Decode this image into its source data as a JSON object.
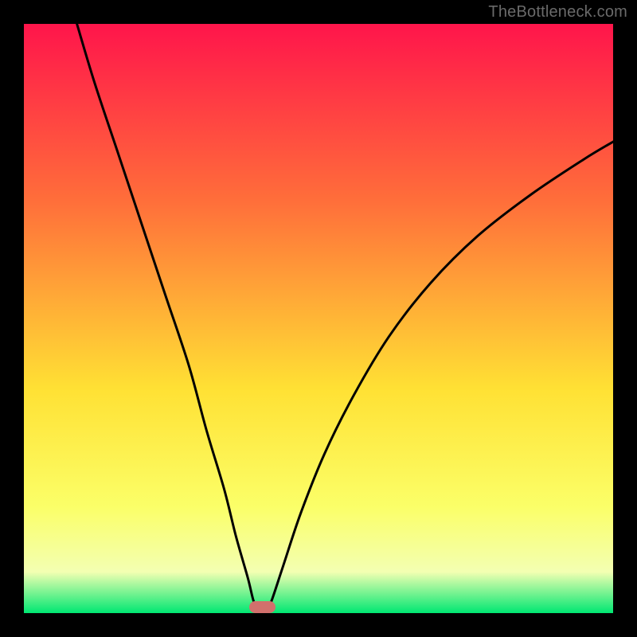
{
  "watermark": "TheBottleneck.com",
  "colors": {
    "black": "#000000",
    "gradient_top": "#ff154b",
    "gradient_mid1": "#ff6e3a",
    "gradient_mid2": "#ffe134",
    "gradient_mid3": "#fbff68",
    "gradient_mid4": "#f3ffb2",
    "gradient_bottom": "#00e772",
    "curve": "#000000",
    "marker": "#d2706c"
  },
  "chart_data": {
    "type": "line",
    "title": "",
    "xlabel": "",
    "ylabel": "",
    "xlim": [
      0,
      100
    ],
    "ylim": [
      0,
      100
    ],
    "minimum_x": 40,
    "minimum_y": 0,
    "curve_points": [
      {
        "x": 9,
        "y": 100
      },
      {
        "x": 12,
        "y": 90
      },
      {
        "x": 16,
        "y": 78
      },
      {
        "x": 20,
        "y": 66
      },
      {
        "x": 24,
        "y": 54
      },
      {
        "x": 28,
        "y": 42
      },
      {
        "x": 31,
        "y": 31
      },
      {
        "x": 34,
        "y": 21
      },
      {
        "x": 36,
        "y": 13
      },
      {
        "x": 38,
        "y": 6
      },
      {
        "x": 39,
        "y": 2
      },
      {
        "x": 40,
        "y": 0
      },
      {
        "x": 41,
        "y": 0
      },
      {
        "x": 42,
        "y": 2
      },
      {
        "x": 44,
        "y": 8
      },
      {
        "x": 47,
        "y": 17
      },
      {
        "x": 51,
        "y": 27
      },
      {
        "x": 56,
        "y": 37
      },
      {
        "x": 62,
        "y": 47
      },
      {
        "x": 69,
        "y": 56
      },
      {
        "x": 77,
        "y": 64
      },
      {
        "x": 86,
        "y": 71
      },
      {
        "x": 95,
        "y": 77
      },
      {
        "x": 100,
        "y": 80
      }
    ],
    "marker": {
      "x": 40.5,
      "width": 4.5,
      "height": 2
    },
    "gradient_stops": [
      {
        "offset": 0,
        "color": "#ff154b"
      },
      {
        "offset": 30,
        "color": "#ff6e3a"
      },
      {
        "offset": 62,
        "color": "#ffe134"
      },
      {
        "offset": 82,
        "color": "#fbff68"
      },
      {
        "offset": 93,
        "color": "#f3ffb2"
      },
      {
        "offset": 100,
        "color": "#00e772"
      }
    ]
  }
}
